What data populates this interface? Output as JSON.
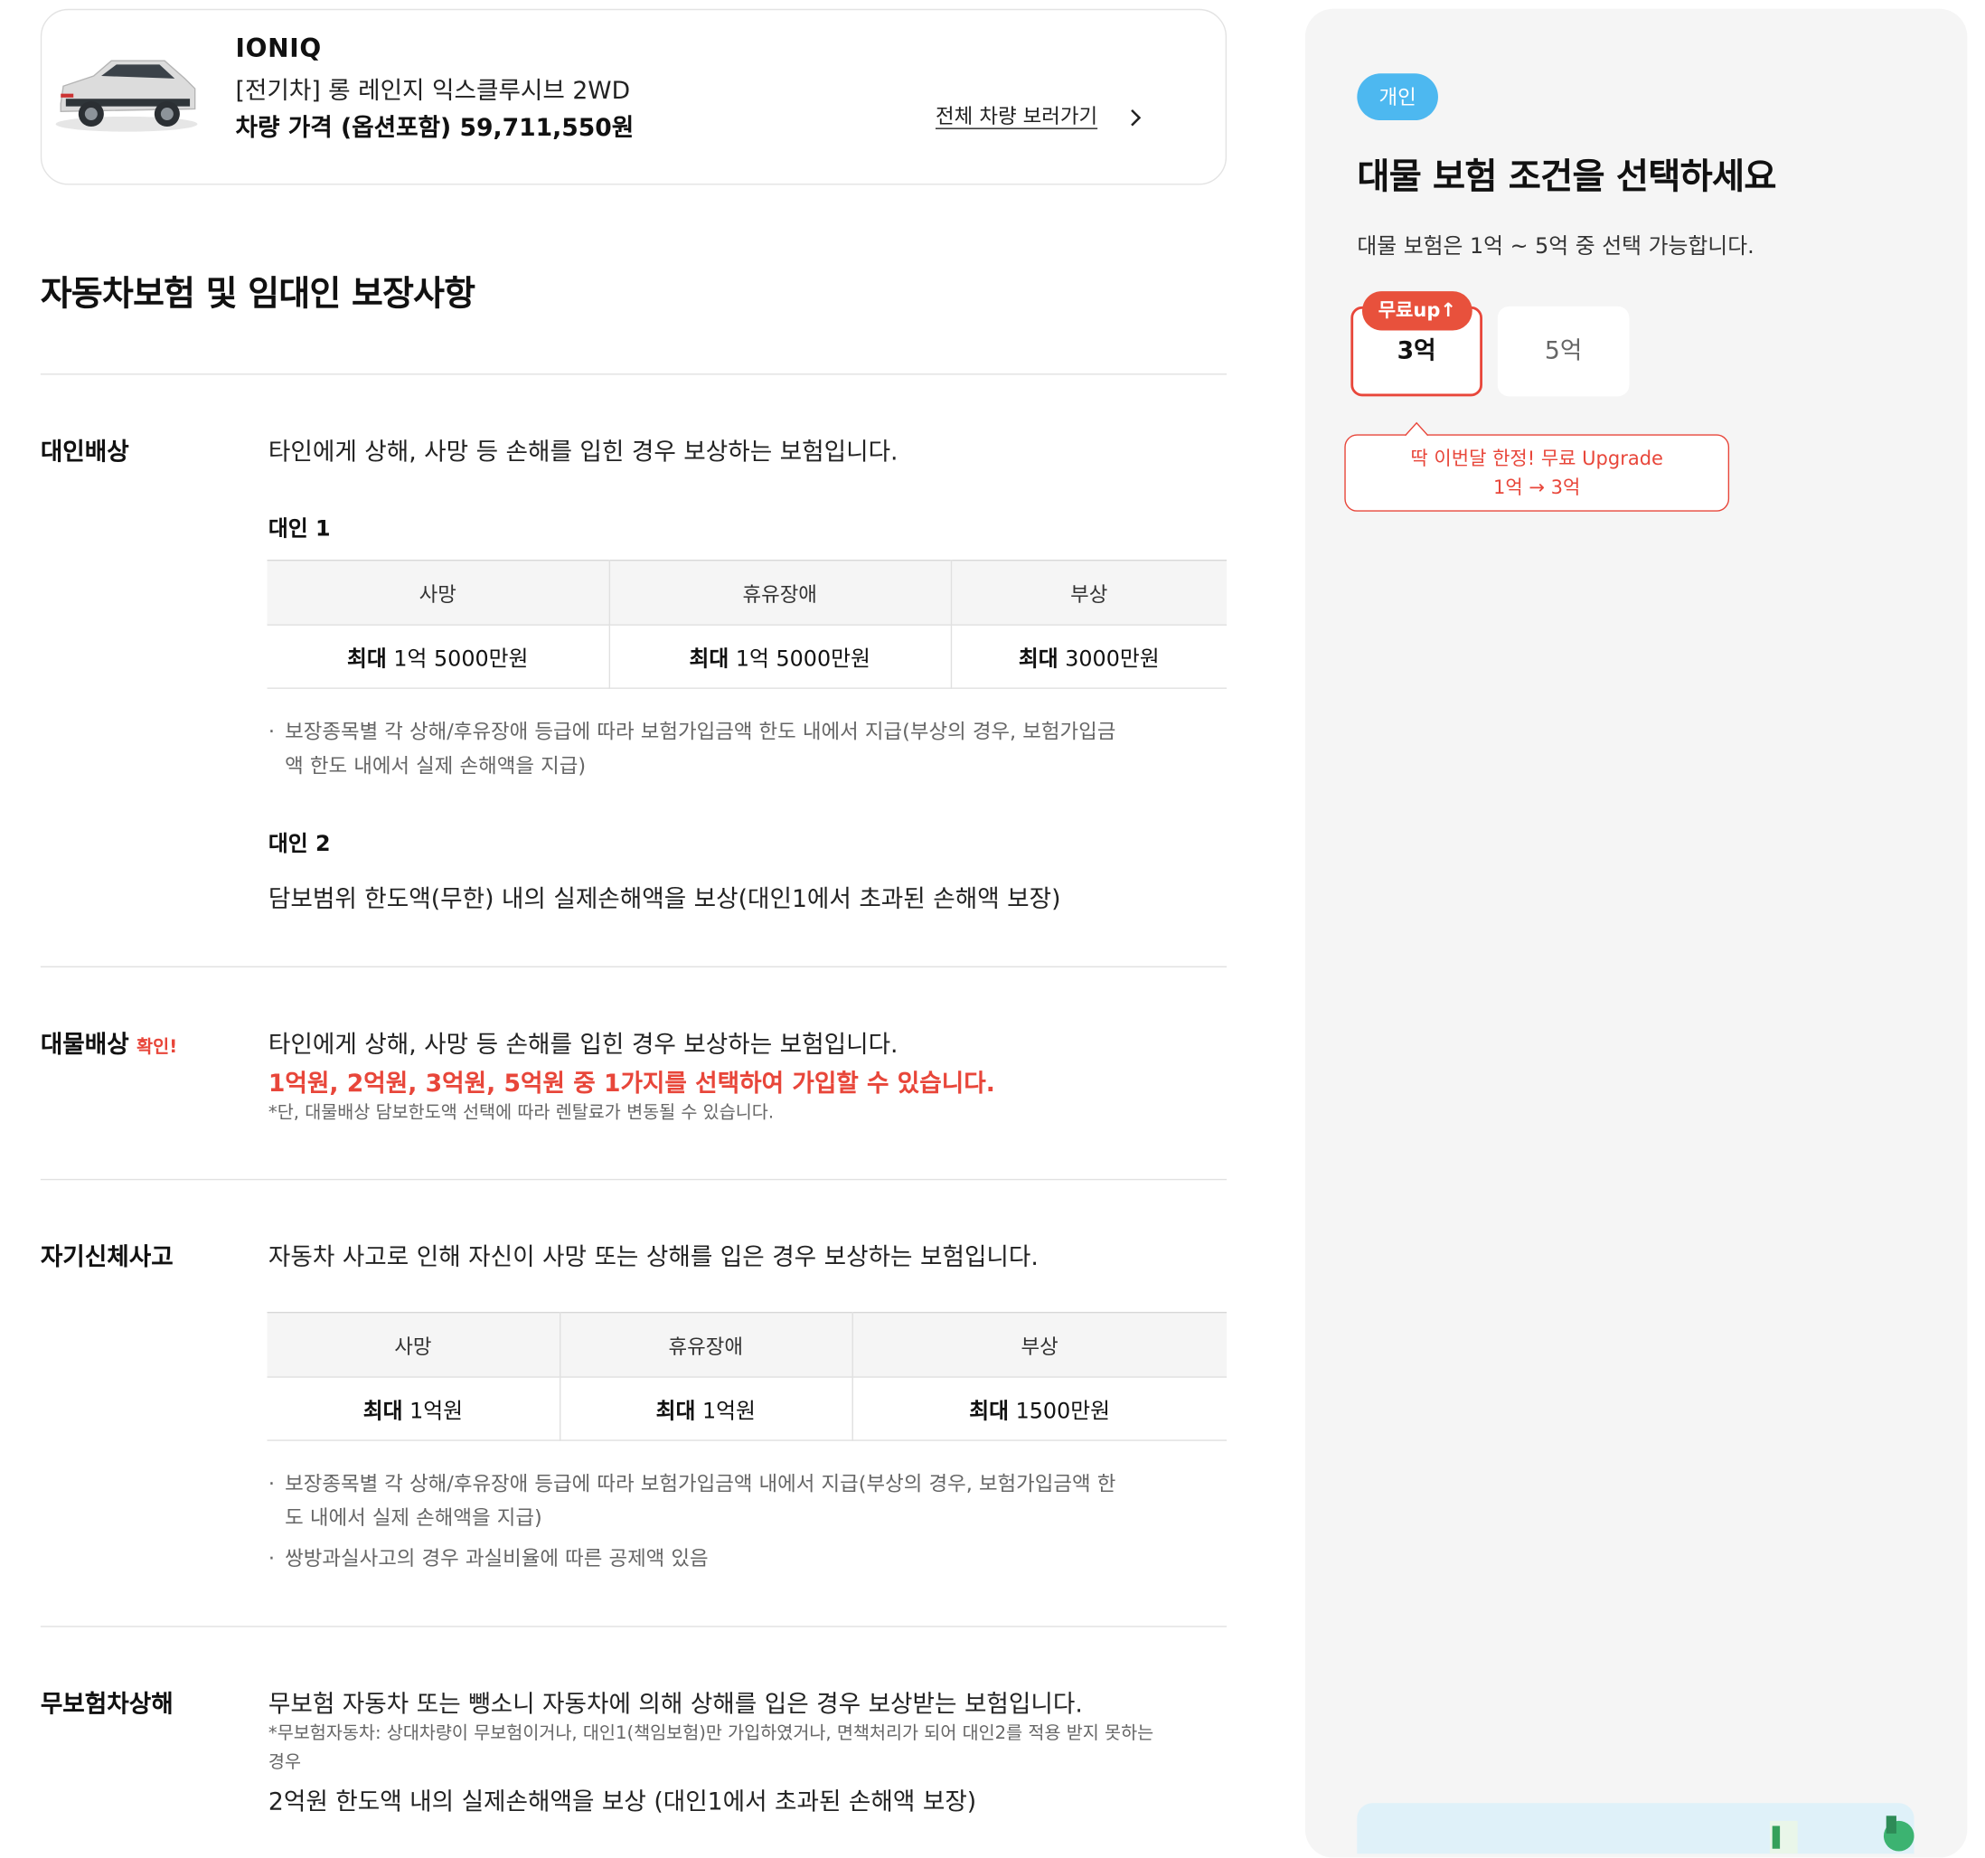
{
  "car": {
    "name": "IONIQ",
    "trim": "[전기차] 롱 레인지 익스클루시브 2WD",
    "price": "차량 가격 (옵션포함) 59,711,550원",
    "view_all": "전체 차량 보러가기"
  },
  "section_title": "자동차보험 및 임대인 보장사항",
  "bodily": {
    "label": "대인배상",
    "desc": "타인에게 상해, 사망 등 손해를 입힌 경우 보상하는 보험입니다.",
    "sub1": "대인 1",
    "headers": [
      "사망",
      "휴유장애",
      "부상"
    ],
    "values": [
      {
        "strong": "최대",
        "value": "1억 5000만원"
      },
      {
        "strong": "최대",
        "value": "1억 5000만원"
      },
      {
        "strong": "최대",
        "value": "3000만원"
      }
    ],
    "note_line1": "보장종목별 각 상해/후유장애 등급에 따라 보험가입금액 한도 내에서 지급(부상의 경우, 보험가입금",
    "note_line2": "액 한도 내에서 실제 손해액을 지급)",
    "sub2": "대인 2",
    "sub2_desc": "담보범위 한도액(무한) 내의 실제손해액을 보상(대인1에서 초과된 손해액 보장)"
  },
  "property": {
    "label": "대물배상",
    "tag": "확인!",
    "desc": "타인에게 상해, 사망 등 손해를 입힌 경우 보상하는 보험입니다.",
    "highlight": "1억원, 2억원, 3억원, 5억원 중 1가지를 선택하여 가입할 수 있습니다.",
    "note": "*단, 대물배상 담보한도액 선택에 따라 렌탈료가 변동될 수 있습니다."
  },
  "self_injury": {
    "label": "자기신체사고",
    "desc": "자동차 사고로 인해 자신이 사망 또는 상해를 입은 경우 보상하는 보험입니다.",
    "headers": [
      "사망",
      "휴유장애",
      "부상"
    ],
    "values": [
      {
        "strong": "최대",
        "value": "1억원"
      },
      {
        "strong": "최대",
        "value": "1억원"
      },
      {
        "strong": "최대",
        "value": "1500만원"
      }
    ],
    "note1_line1": "보장종목별 각 상해/후유장애 등급에 따라 보험가입금액 내에서 지급(부상의 경우, 보험가입금액 한",
    "note1_line2": "도 내에서 실제 손해액을 지급)",
    "note2": "쌍방과실사고의 경우 과실비율에 따른 공제액 있음"
  },
  "uninsured": {
    "label": "무보험차상해",
    "desc": "무보험 자동차 또는 뺑소니 자동차에 의해 상해를 입은 경우 보상받는 보험입니다.",
    "note_line1": "*무보험자동차: 상대차량이 무보험이거나, 대인1(책임보험)만 가입하였거나, 면책처리가 되어 대인2를 적용 받지 못하는",
    "note_line2": "경우",
    "desc2": "2억원 한도액 내의 실제손해액을 보상 (대인1에서 초과된 손해액 보장)"
  },
  "panel": {
    "badge": "개인",
    "title": "대물 보험 조건을 선택하세요",
    "subtitle": "대물 보험은 1억 ~ 5억 중 선택 가능합니다.",
    "free_up": "무료up↑",
    "option_selected": "3억",
    "option_other": "5억",
    "tooltip_line1": "딱 이번달 한정! 무료 Upgrade",
    "tooltip_line2": "1억 → 3억"
  },
  "colors": {
    "accent_red": "#e8463a",
    "badge_blue": "#4db8f0",
    "panel_bg": "#f5f5f5"
  }
}
